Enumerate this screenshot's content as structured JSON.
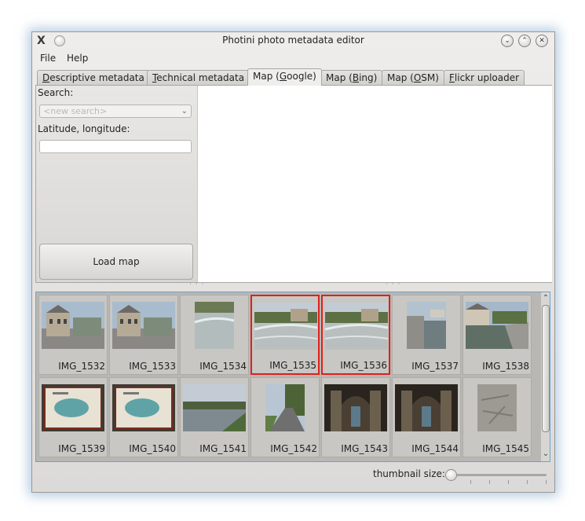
{
  "window": {
    "title": "Photini photo metadata editor",
    "app_icon": "X",
    "controls": [
      "minimize",
      "maximize",
      "close"
    ]
  },
  "menu": [
    "File",
    "Help"
  ],
  "tabs": [
    {
      "pre": "",
      "u": "D",
      "post": "escriptive metadata",
      "active": false
    },
    {
      "pre": "",
      "u": "T",
      "post": "echnical metadata",
      "active": false
    },
    {
      "pre": "Map (",
      "u": "G",
      "post": "oogle)",
      "active": true
    },
    {
      "pre": "Map (",
      "u": "B",
      "post": "ing)",
      "active": false
    },
    {
      "pre": "Map (",
      "u": "O",
      "post": "SM)",
      "active": false
    },
    {
      "pre": "",
      "u": "F",
      "post": "lickr uploader",
      "active": false
    }
  ],
  "map_panel": {
    "search_label": "Search:",
    "search_placeholder": "<new search>",
    "latlon_label": "Latitude, longitude:",
    "latlon_value": "",
    "load_button": "Load map"
  },
  "thumbnails": [
    {
      "name": "IMG_1532",
      "selected": false,
      "scene": "building"
    },
    {
      "name": "IMG_1533",
      "selected": false,
      "scene": "building"
    },
    {
      "name": "IMG_1534",
      "selected": false,
      "scene": "weir-portrait"
    },
    {
      "name": "IMG_1535",
      "selected": true,
      "scene": "weir"
    },
    {
      "name": "IMG_1536",
      "selected": true,
      "scene": "weir"
    },
    {
      "name": "IMG_1537",
      "selected": false,
      "scene": "lock-portrait"
    },
    {
      "name": "IMG_1538",
      "selected": false,
      "scene": "canal"
    },
    {
      "name": "IMG_1539",
      "selected": false,
      "scene": "sign-map"
    },
    {
      "name": "IMG_1540",
      "selected": false,
      "scene": "sign-map"
    },
    {
      "name": "IMG_1541",
      "selected": false,
      "scene": "river"
    },
    {
      "name": "IMG_1542",
      "selected": false,
      "scene": "road-portrait"
    },
    {
      "name": "IMG_1543",
      "selected": false,
      "scene": "cave"
    },
    {
      "name": "IMG_1544",
      "selected": false,
      "scene": "cave"
    },
    {
      "name": "IMG_1545",
      "selected": false,
      "scene": "stone-portrait"
    }
  ],
  "footer": {
    "thumbnail_size_label": "thumbnail size:",
    "thumbnail_size_level": 0
  },
  "colors": {
    "selection": "#e0201c",
    "focus_frame": "#6aa3d0"
  }
}
